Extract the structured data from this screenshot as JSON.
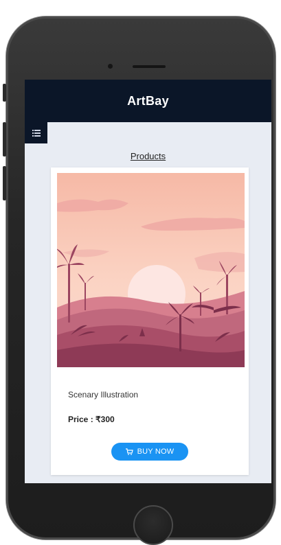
{
  "app": {
    "title": "ArtBay"
  },
  "page": {
    "section_title": "Products"
  },
  "product": {
    "name": "Scenary Illustration",
    "price": "Price : ₹300",
    "buy_label": "BUY NOW"
  },
  "icons": {
    "menu": "list-icon",
    "cart": "cart-icon"
  },
  "colors": {
    "appbar": "#0b1628",
    "screen_bg": "#e8ecf3",
    "button": "#1a93f3"
  }
}
